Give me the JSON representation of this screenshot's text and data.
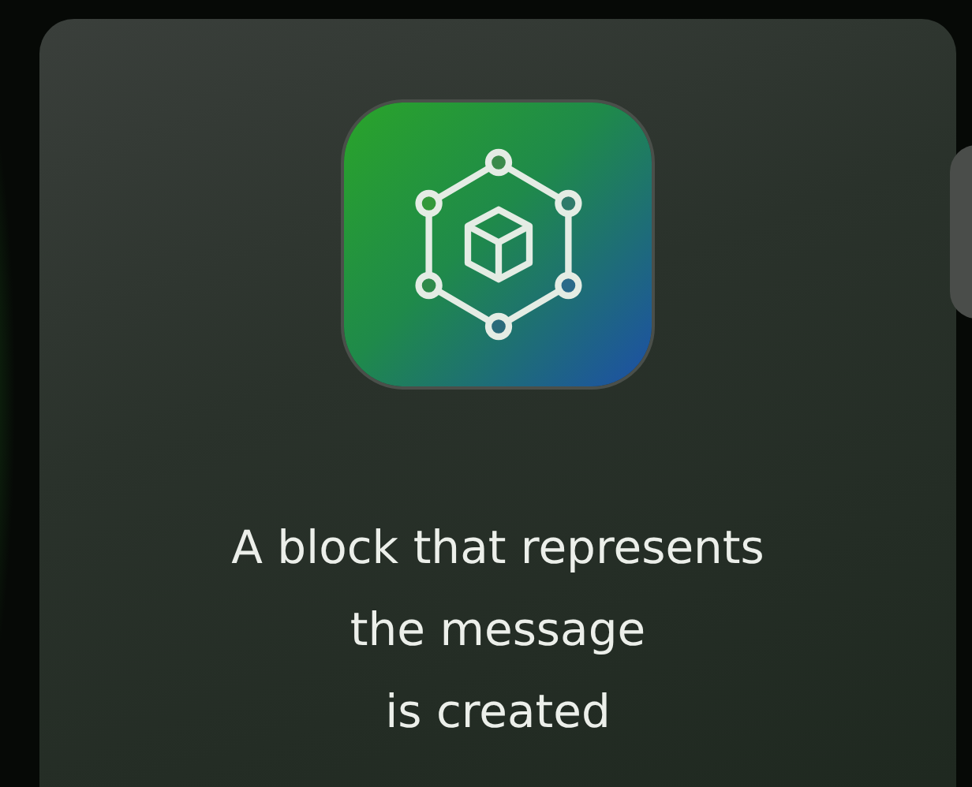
{
  "card": {
    "caption": "A block that represents\nthe message\nis created"
  }
}
